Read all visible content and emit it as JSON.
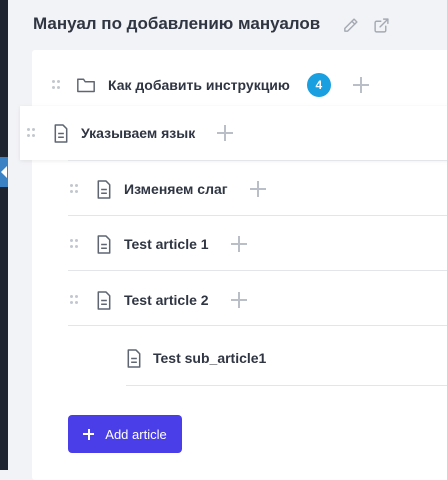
{
  "header": {
    "title": "Мануал по добавлению мануалов",
    "edit_icon": "pencil-icon",
    "open_icon": "external-link-icon"
  },
  "tree": {
    "category": {
      "label": "Как добавить инструкцию",
      "count": "4",
      "icon": "folder-icon"
    },
    "dragging_item": {
      "label": "Указываем язык",
      "icon": "document-icon"
    },
    "items": [
      {
        "label": "Изменяем слаг",
        "icon": "document-icon"
      },
      {
        "label": "Test article 1",
        "icon": "document-icon"
      },
      {
        "label": "Test article 2",
        "icon": "document-icon"
      }
    ],
    "sub_items": [
      {
        "label": "Test sub_article1",
        "icon": "document-icon"
      }
    ]
  },
  "footer": {
    "add_article_label": "Add article"
  },
  "colors": {
    "accent": "#4a3ee8",
    "badge": "#1a9fe0",
    "sidebar": "#1e2430",
    "collapse_tab": "#3b82c4"
  }
}
